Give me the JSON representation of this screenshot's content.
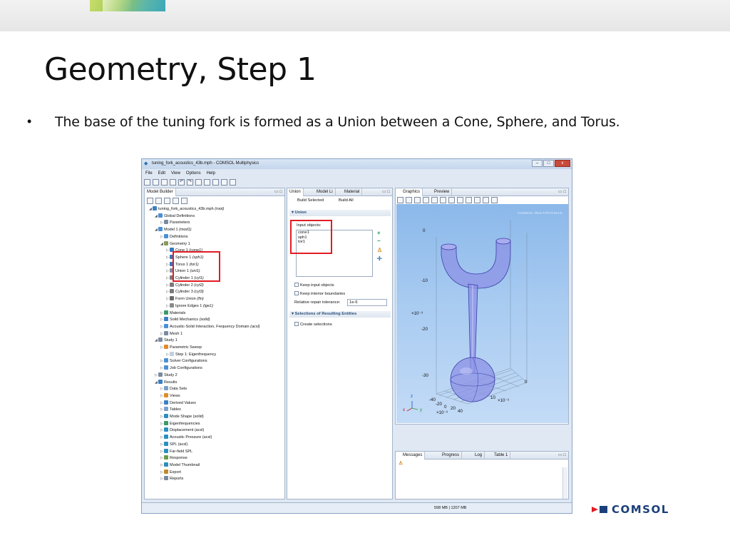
{
  "slide": {
    "title": "Geometry, Step 1",
    "bullet": "The base of the tuning fork is formed as a Union between a Cone, Sphere, and Torus.",
    "bullet_symbol": "•",
    "logo_text": "COMSOL"
  },
  "window": {
    "title": "tuning_fork_acoustics_43b.mph - COMSOL Multiphysics",
    "controls": {
      "minimize": "–",
      "maximize": "□",
      "close": "x"
    },
    "menu": [
      "File",
      "Edit",
      "View",
      "Options",
      "Help"
    ],
    "status_memory": "598 MB | 1207 MB"
  },
  "model_builder": {
    "tab": "Model Builder",
    "tree": [
      {
        "label": "tuning_fork_acoustics_43b.mph",
        "tag": "(root)",
        "color": "#3b7fc4"
      },
      {
        "label": "Global Definitions",
        "tag": "",
        "color": "#4a8fd6"
      },
      {
        "label": "Parameters",
        "tag": "",
        "color": "#7a8aa0"
      },
      {
        "label": "Model 1",
        "tag": "(mod1)",
        "color": "#4a8fd6"
      },
      {
        "label": "Definitions",
        "tag": "",
        "color": "#4a8fd6"
      },
      {
        "label": "Geometry 1",
        "tag": "",
        "color": "#8a9a5a"
      },
      {
        "label": "Cone 1",
        "tag": "(cone1)",
        "color": "#3577c0"
      },
      {
        "label": "Sphere 1",
        "tag": "(sph1)",
        "color": "#3577c0"
      },
      {
        "label": "Torus 1",
        "tag": "(tor1)",
        "color": "#3577c0"
      },
      {
        "label": "Union 1",
        "tag": "(uni1)",
        "color": "#7b8fa8"
      },
      {
        "label": "Cylinder 1",
        "tag": "(cyl1)",
        "color": "#7a7a7a"
      },
      {
        "label": "Cylinder 2",
        "tag": "(cyl2)",
        "color": "#7a7a7a"
      },
      {
        "label": "Cylinder 3",
        "tag": "(cyl3)",
        "color": "#7a7a7a"
      },
      {
        "label": "Form Union",
        "tag": "(fin)",
        "color": "#6a6a6a"
      },
      {
        "label": "Ignore Edges 1",
        "tag": "(ige1)",
        "color": "#8a8a8a"
      },
      {
        "label": "Materials",
        "tag": "",
        "color": "#3a9a6a"
      },
      {
        "label": "Solid Mechanics",
        "tag": "(solid)",
        "color": "#3b7fc4"
      },
      {
        "label": "Acoustic-Solid Interaction, Frequency Domain",
        "tag": "(acsl)",
        "color": "#4a8fd6"
      },
      {
        "label": "Mesh 1",
        "tag": "",
        "color": "#7a8aa0"
      },
      {
        "label": "Study 1",
        "tag": "",
        "color": "#7a8aa0"
      },
      {
        "label": "Parametric Sweep",
        "tag": "",
        "color": "#e08a2a"
      },
      {
        "label": "Step 1: Eigenfrequency",
        "tag": "",
        "color": "#c0d0e0"
      },
      {
        "label": "Solver Configurations",
        "tag": "",
        "color": "#4a8fd6"
      },
      {
        "label": "Job Configurations",
        "tag": "",
        "color": "#4a8fd6"
      },
      {
        "label": "Study 2",
        "tag": "",
        "color": "#7a8aa0"
      },
      {
        "label": "Results",
        "tag": "",
        "color": "#3b7fc4"
      },
      {
        "label": "Data Sets",
        "tag": "",
        "color": "#7aa0c8"
      },
      {
        "label": "Views",
        "tag": "",
        "color": "#e08a2a"
      },
      {
        "label": "Derived Values",
        "tag": "",
        "color": "#3b7fc4"
      },
      {
        "label": "Tables",
        "tag": "",
        "color": "#7aa0c8"
      },
      {
        "label": "Mode Shape (solid)",
        "tag": "",
        "color": "#2a8fc0"
      },
      {
        "label": "Eigenfrequencies",
        "tag": "",
        "color": "#3a9a6a"
      },
      {
        "label": "Displacement (acsl)",
        "tag": "",
        "color": "#2a8fc0"
      },
      {
        "label": "Acoustic Pressure (acsl)",
        "tag": "",
        "color": "#2a8fc0"
      },
      {
        "label": "SPL (acsl)",
        "tag": "",
        "color": "#2a8fc0"
      },
      {
        "label": "Far-field SPL",
        "tag": "",
        "color": "#2a8fc0"
      },
      {
        "label": "Response",
        "tag": "",
        "color": "#6a9a4a"
      },
      {
        "label": "Model Thumbnail",
        "tag": "",
        "color": "#2a8fc0"
      },
      {
        "label": "Export",
        "tag": "",
        "color": "#c08a2a"
      },
      {
        "label": "Reports",
        "tag": "",
        "color": "#7a8aa0"
      }
    ]
  },
  "settings": {
    "tabs": [
      "Union",
      "Model Li",
      "Material"
    ],
    "build_selected": "Build Selected",
    "build_all": "Build All",
    "section_union": "Union",
    "input_objects_label": "Input objects:",
    "input_objects": [
      "cone1",
      "sph1",
      "tor1"
    ],
    "keep_input": "Keep input objects",
    "keep_interior": "Keep interior boundaries",
    "repair_label": "Relative repair tolerance:",
    "repair_value": "1e-6",
    "section_selections": "Selections of Resulting Entities",
    "create_selections": "Create selections"
  },
  "graphics": {
    "tabs": [
      "Graphics",
      "Preview"
    ],
    "watermark": "COMSOL MULTIPHYSICS",
    "z_ticks": [
      "0",
      "-10",
      "-20",
      "-30"
    ],
    "z_scale": "×10⁻³",
    "x_ticks": [
      "-40",
      "-20",
      "0",
      "20",
      "40"
    ],
    "x_scale": "×10⁻³",
    "y_ticks": [
      "10",
      "0"
    ],
    "y_scale": "×10⁻³",
    "triad": {
      "x": "x",
      "y": "y",
      "z": "z"
    }
  },
  "messages": {
    "tabs": [
      "Messages",
      "Progress",
      "Log",
      "Table 1"
    ]
  }
}
